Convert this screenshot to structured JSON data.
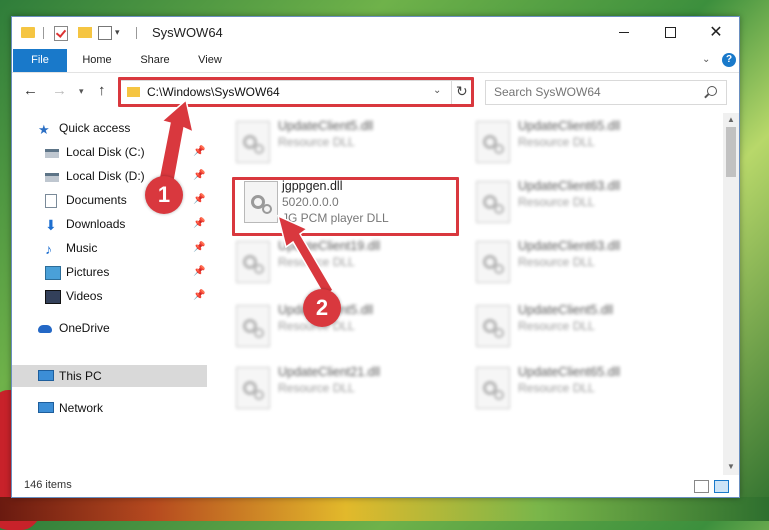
{
  "window": {
    "title": "SysWOW64",
    "min_label": "",
    "max_label": "",
    "close_label": "✕"
  },
  "ribbon": {
    "tabs": [
      {
        "label": "File"
      },
      {
        "label": "Home"
      },
      {
        "label": "Share"
      },
      {
        "label": "View"
      }
    ],
    "help": "?"
  },
  "address": {
    "path": "C:\\Windows\\SysWOW64"
  },
  "search": {
    "placeholder": "Search SysWOW64"
  },
  "sidebar": {
    "items": [
      {
        "label": "Quick access",
        "icon": "star-icon"
      },
      {
        "label": "Local Disk (C:)",
        "icon": "disk-icon",
        "pinned": true
      },
      {
        "label": "Local Disk (D:)",
        "icon": "disk-icon",
        "pinned": true
      },
      {
        "label": "Documents",
        "icon": "documents-icon",
        "pinned": true
      },
      {
        "label": "Downloads",
        "icon": "downloads-icon",
        "pinned": true
      },
      {
        "label": "Music",
        "icon": "music-icon",
        "pinned": true
      },
      {
        "label": "Pictures",
        "icon": "pictures-icon",
        "pinned": true
      },
      {
        "label": "Videos",
        "icon": "videos-icon",
        "pinned": true
      },
      {
        "label": "OneDrive",
        "icon": "onedrive-icon"
      },
      {
        "label": "This PC",
        "icon": "this-pc-icon",
        "selected": true
      },
      {
        "label": "Network",
        "icon": "network-icon"
      }
    ]
  },
  "files": {
    "highlighted": {
      "name": "jgppgen.dll",
      "version": "5020.0.0.0",
      "description": "JG PCM player DLL"
    },
    "left_column": [
      {
        "name": "UpdateClient5.dll",
        "description": "Resource DLL"
      },
      {
        "name": "UpdateClient19.dll",
        "description": "Resource DLL"
      },
      {
        "name": "UpdateClient5.dll",
        "description": "Resource DLL"
      },
      {
        "name": "UpdateClient21.dll",
        "description": "Resource DLL"
      }
    ],
    "right_column": [
      {
        "name": "UpdateClient65.dll",
        "description": "Resource DLL"
      },
      {
        "name": "UpdateClient63.dll",
        "description": "Resource DLL"
      },
      {
        "name": "UpdateClient63.dll",
        "description": "Resource DLL"
      },
      {
        "name": "UpdateClient5.dll",
        "description": "Resource DLL"
      },
      {
        "name": "UpdateClient65.dll",
        "description": "Resource DLL"
      }
    ]
  },
  "status": {
    "item_count": "146 items"
  },
  "annotations": {
    "step1": "1",
    "step2": "2",
    "color": "#d9383e"
  }
}
